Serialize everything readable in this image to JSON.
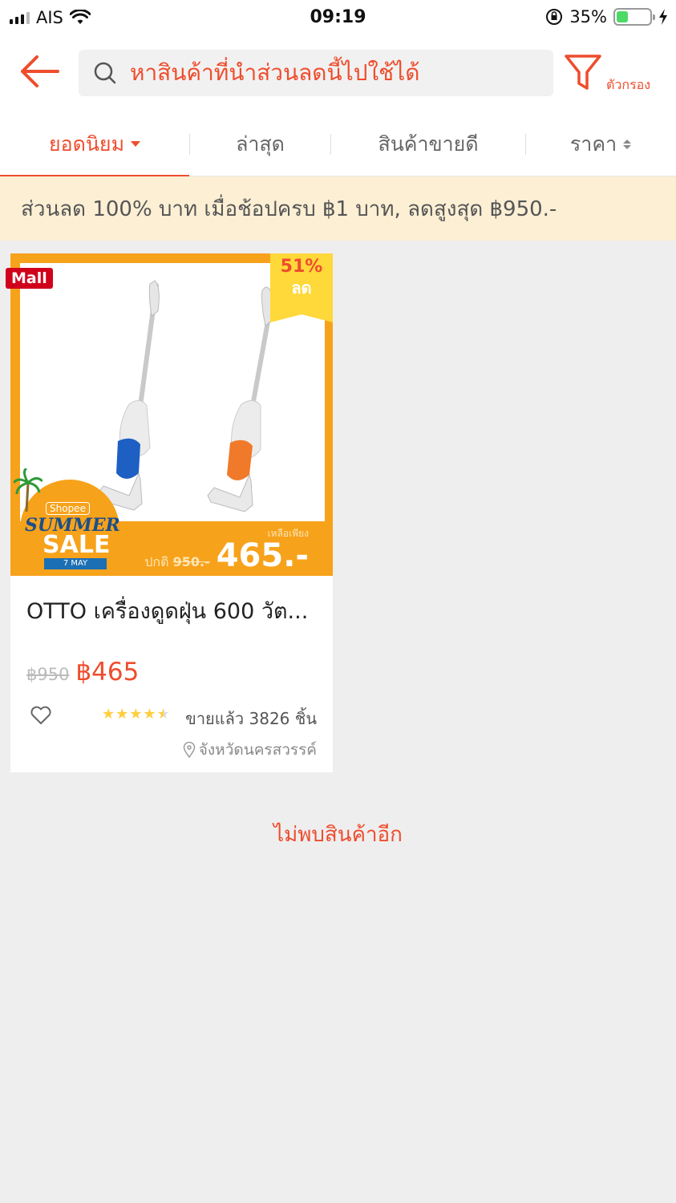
{
  "status_bar": {
    "carrier": "AIS",
    "time": "09:19",
    "battery_percent": "35%",
    "battery_level": 0.35,
    "icons": [
      "signal-icon",
      "wifi-icon",
      "orientation-lock-icon",
      "battery-icon",
      "charging-icon"
    ]
  },
  "header": {
    "back_icon": "arrow-left-icon",
    "search_icon": "search-icon",
    "search_placeholder": "หาสินค้าที่นำส่วนลดนี้ไปใช้ได้",
    "filter_icon": "filter-icon",
    "filter_label": "ตัวกรอง"
  },
  "tabs": [
    {
      "label": "ยอดนิยม",
      "active": true
    },
    {
      "label": "ล่าสุด",
      "active": false
    },
    {
      "label": "สินค้าขายดี",
      "active": false
    },
    {
      "label": "ราคา",
      "active": false
    }
  ],
  "voucher": {
    "text": "ส่วนลด 100% บาท เมื่อช้อปครบ ฿1 บาท, ลดสูงสุด ฿950.-"
  },
  "product": {
    "mall_badge": "Mall",
    "discount_percent": "51%",
    "discount_label": "ลด",
    "campaign": {
      "shopee": "Shopee",
      "summer": "SUMMER",
      "sale": "SALE",
      "date": "7 MAY"
    },
    "promo_from": "เหลือเพียง",
    "promo_old_prefix": "ปกติ",
    "promo_old_price": "950.-",
    "promo_new_price": "465.-",
    "name": "OTTO เครื่องดูดฝุ่น 600 วัต...",
    "original_price": "฿950",
    "price": "฿465",
    "rating": 4.5,
    "sold": "ขายแล้ว 3826 ชิ้น",
    "location": "จังหวัดนครสวรรค์"
  },
  "footer_message": "ไม่พบสินค้าอีก",
  "colors": {
    "accent": "#ee4d2d",
    "voucher_bg": "#fcefd4",
    "page_bg": "#efeeef",
    "sale_orange": "#f7a21b",
    "mall_red": "#d0011b",
    "discount_yellow": "#ffd839"
  }
}
